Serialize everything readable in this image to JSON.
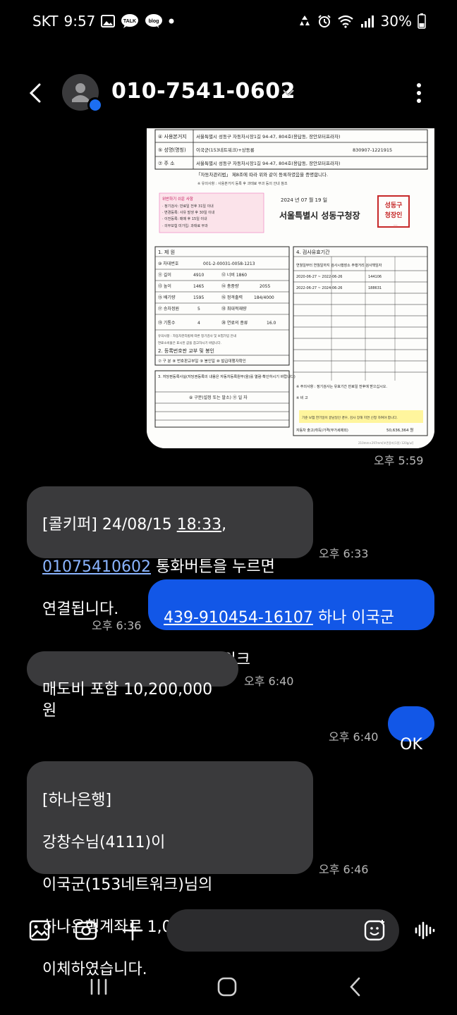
{
  "status_bar": {
    "carrier": "SKT",
    "time": "9:57",
    "battery": "30%",
    "left_icons": [
      "gallery-icon",
      "talk-icon",
      "blog-icon",
      "dot-icon"
    ],
    "right_icons": [
      "recycle-icon",
      "alarm-icon",
      "wifi-icon",
      "signal-icon",
      "battery-icon"
    ]
  },
  "header": {
    "contact": "010-7541-0602",
    "icons": [
      "back-icon",
      "avatar-icon",
      "chevron-down-icon",
      "more-icon"
    ]
  },
  "image_message": {
    "time": "오후 5:59",
    "doc": {
      "seal": "성동구청장인",
      "issuer": "서울특별시 성동구청장",
      "date": "2024 년 07 월 19 일",
      "addr1": "서울특별시 성동구 자동차시장1길 94-47, 804호(용답동, 장안모터프라자)",
      "owner": "이국군(153네트워크)+상동룡",
      "reg_no": "830907-1221915",
      "notice": "「자동차관리법」 제8조에 따라 위와 같이 등록하였음을 증명합니다.",
      "section1": "1. 제 원",
      "section4": "4. 검사유효기간",
      "section2": "2. 등록번호판 교부 및 봉인",
      "section3": "3. 저당권등록사실(저당권등록의 내용은 자동차등록원부(을)를 열람·확인하시기 바랍니다)",
      "spec_id": "001-2-00031-0058-1213",
      "spec_len": "4910",
      "spec_height": "1465",
      "spec_disp": "1595",
      "spec_wt": "2055",
      "spec_out": "184/4000",
      "spec_fuel": "16.0",
      "spec_seats": "5",
      "spec_cyl": "4",
      "insp1": "2020-06-27 ~ 2022-06-26",
      "insp2": "2022-06-27 ~ 2024-06-26",
      "odo1": "144106",
      "odo2": "188631",
      "price": "50,636,364 원",
      "warning": "기준 보험 한기일이 끝남일인 경우, 검사 장해 지연 신청 하여야 합니다."
    }
  },
  "messages": [
    {
      "dir": "in",
      "time": "오후 6:33",
      "text_a": "[콜키퍼] 24/08/15 ",
      "text_b": "18:33",
      "text_c": ",",
      "link": "01075410602",
      "text_d": " 통화버튼을 누르면",
      "text_e": "연결됩니다."
    },
    {
      "dir": "out",
      "time": "오후 6:36",
      "link": "439-910454-16107",
      "text": " 하나 이국군",
      "text2": "153네트워크"
    },
    {
      "dir": "in",
      "time": "오후 6:40",
      "text": "매도비 포함 10,200,000원"
    },
    {
      "dir": "out",
      "time": "오후 6:40",
      "text": "OK"
    },
    {
      "dir": "in",
      "time": "오후 6:46",
      "lines": [
        "[하나은행]",
        "강창수님(4111)이",
        "이국군(153네트워크)님의",
        "하나은행계좌로 1,000,000원을",
        "이체하였습니다."
      ]
    }
  ],
  "composer": {
    "placeholder": "",
    "icons": [
      "gallery-icon",
      "camera-icon",
      "plus-icon",
      "emoji-icon",
      "voice-icon"
    ]
  },
  "nav": {
    "icons": [
      "recents-icon",
      "home-icon",
      "back-icon"
    ]
  },
  "colors": {
    "background": "#000000",
    "incoming": "#3a3a3c",
    "outgoing": "#1257e7",
    "link": "#8ab4ff"
  }
}
